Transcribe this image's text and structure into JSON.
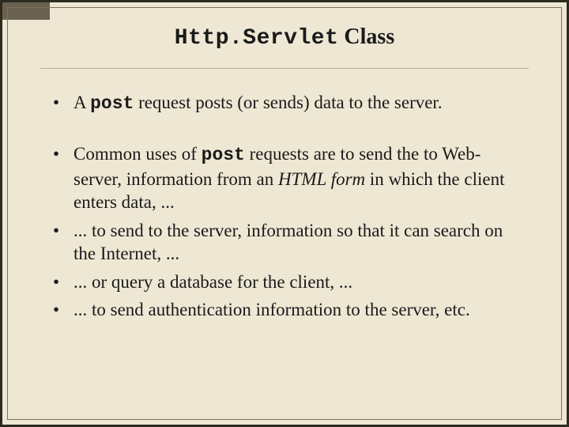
{
  "title": {
    "mono": "Http.Servlet",
    "serif": " Class"
  },
  "bullets": {
    "b1": {
      "t1": "A ",
      "code": "post",
      "t2": " request posts (or sends) data to the server."
    },
    "b2": {
      "t1": "Common uses of ",
      "code": "post",
      "t2": " requests are to send the to Web-server, information from an ",
      "italic": "HTML form",
      "t3": " in which the client enters data, ..."
    },
    "b3": "... to send to the server, information so that it can search on the Internet, ...",
    "b4": "... or query a database for the client, ...",
    "b5": "... to send authentication information to the server, etc."
  }
}
